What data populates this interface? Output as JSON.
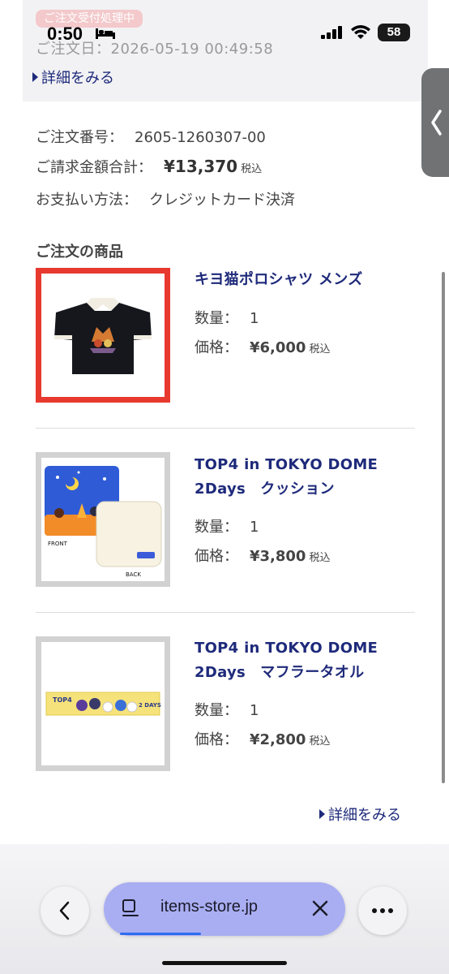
{
  "status_bar": {
    "time": "0:50",
    "battery": "58"
  },
  "header": {
    "status_badge": "ご注文受付処理中",
    "order_date": "ご注文日：2026-05-19 00:49:58",
    "detail_link": "詳細をみる"
  },
  "summary": {
    "order_number_label": "ご注文番号：",
    "order_number": "2605-1260307-00",
    "total_label": "ご請求金額合計：",
    "total": "¥13,370",
    "total_tax": "税込",
    "payment_label": "お支払い方法：",
    "payment": "クレジットカード決済"
  },
  "items_section": {
    "title": "ご注文の商品",
    "qty_label": "数量：",
    "price_label": "価格：",
    "tax_label": "税込",
    "items": [
      {
        "name_line1": "キヨ猫ポロシャツ メンズ",
        "name_line2": "",
        "quantity": "1",
        "price": "¥6,000",
        "thumb_icon": "polo-shirt-image"
      },
      {
        "name_line1": "TOP4 in TOKYO DOME",
        "name_line2": "2Days　クッション",
        "quantity": "1",
        "price": "¥3,800",
        "thumb_icon": "cushion-image",
        "thumb_labels": [
          "FRONT",
          "BACK"
        ]
      },
      {
        "name_line1": "TOP4 in TOKYO DOME",
        "name_line2": "2Days　マフラータオル",
        "quantity": "1",
        "price": "¥2,800",
        "thumb_icon": "muffler-towel-image",
        "thumb_labels": [
          "TOP4",
          "2 DAYS"
        ]
      }
    ]
  },
  "footer_link": "詳細をみる",
  "browser": {
    "url": "items-store.jp"
  },
  "colors": {
    "link": "#1e2a7a",
    "selected_border": "#e8392f",
    "url_pill": "#a9aef2"
  }
}
